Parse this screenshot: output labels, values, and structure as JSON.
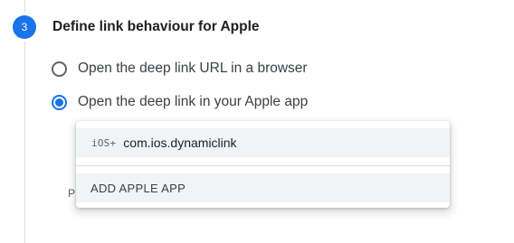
{
  "step": {
    "number": "3",
    "title": "Define link behaviour for Apple"
  },
  "options": [
    {
      "label": "Open the deep link URL in a browser",
      "selected": false
    },
    {
      "label": "Open the deep link in your Apple app",
      "selected": true
    }
  ],
  "partially_hidden_label": "P",
  "dropdown": {
    "app_item": {
      "icon": "ios-icon",
      "icon_text": "iOS+",
      "label": "com.ios.dynamiclink"
    },
    "add_item": {
      "label": "ADD APPLE APP"
    }
  },
  "colors": {
    "accent": "#1a73e8",
    "item_bg": "#f1f3f4",
    "divider": "#dadce0"
  }
}
